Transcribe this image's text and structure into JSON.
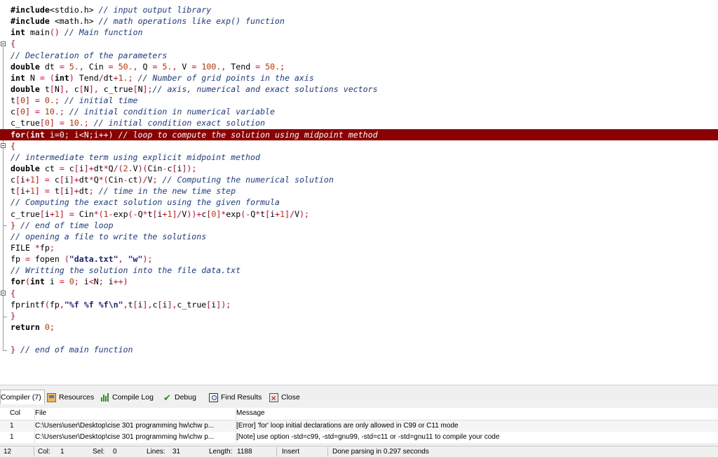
{
  "editor": {
    "lines": [
      [
        [
          "k",
          "#include"
        ],
        [
          "t",
          "<stdio.h> "
        ],
        [
          "c",
          "// input output library"
        ]
      ],
      [
        [
          "k",
          "#include "
        ],
        [
          "t",
          "<math.h> "
        ],
        [
          "c",
          "// math operations like exp() function"
        ]
      ],
      [
        [
          "k",
          "int "
        ],
        [
          "t",
          "main"
        ],
        [
          "o",
          "() "
        ],
        [
          "c",
          "// Main function"
        ]
      ],
      [
        [
          "o",
          "{"
        ]
      ],
      [
        [
          "c",
          "// Decleration of the parameters"
        ]
      ],
      [
        [
          "k",
          "double "
        ],
        [
          "t",
          "dt "
        ],
        [
          "o",
          "= "
        ],
        [
          "n",
          "5."
        ],
        [
          "o",
          ", "
        ],
        [
          "t",
          "Cin "
        ],
        [
          "o",
          "= "
        ],
        [
          "n",
          "50."
        ],
        [
          "o",
          ", "
        ],
        [
          "t",
          "Q "
        ],
        [
          "o",
          "= "
        ],
        [
          "n",
          "5."
        ],
        [
          "o",
          ", "
        ],
        [
          "t",
          "V "
        ],
        [
          "o",
          "= "
        ],
        [
          "n",
          "100."
        ],
        [
          "o",
          ", "
        ],
        [
          "t",
          "Tend "
        ],
        [
          "o",
          "= "
        ],
        [
          "n",
          "50."
        ],
        [
          "o",
          ";"
        ]
      ],
      [
        [
          "k",
          "int "
        ],
        [
          "t",
          "N "
        ],
        [
          "o",
          "= ("
        ],
        [
          "k",
          "int"
        ],
        [
          "o",
          ") "
        ],
        [
          "t",
          "Tend"
        ],
        [
          "o",
          "/"
        ],
        [
          "t",
          "dt"
        ],
        [
          "o",
          "+"
        ],
        [
          "n",
          "1."
        ],
        [
          "o",
          "; "
        ],
        [
          "c",
          "// Number of grid points in the axis"
        ]
      ],
      [
        [
          "k",
          "double "
        ],
        [
          "t",
          "t"
        ],
        [
          "o",
          "["
        ],
        [
          "t",
          "N"
        ],
        [
          "o",
          "], "
        ],
        [
          "t",
          "c"
        ],
        [
          "o",
          "["
        ],
        [
          "t",
          "N"
        ],
        [
          "o",
          "], "
        ],
        [
          "t",
          "c_true"
        ],
        [
          "o",
          "["
        ],
        [
          "t",
          "N"
        ],
        [
          "o",
          "];"
        ],
        [
          "c",
          "// axis, numerical and exact solutions vectors"
        ]
      ],
      [
        [
          "t",
          "t"
        ],
        [
          "o",
          "["
        ],
        [
          "n",
          "0"
        ],
        [
          "o",
          "] = "
        ],
        [
          "n",
          "0."
        ],
        [
          "o",
          "; "
        ],
        [
          "c",
          "// initial time"
        ]
      ],
      [
        [
          "t",
          "c"
        ],
        [
          "o",
          "["
        ],
        [
          "n",
          "0"
        ],
        [
          "o",
          "] = "
        ],
        [
          "n",
          "10."
        ],
        [
          "o",
          "; "
        ],
        [
          "c",
          "// initial condition in numerical variable"
        ]
      ],
      [
        [
          "t",
          "c_true"
        ],
        [
          "o",
          "["
        ],
        [
          "n",
          "0"
        ],
        [
          "o",
          "] = "
        ],
        [
          "n",
          "10."
        ],
        [
          "o",
          "; "
        ],
        [
          "c",
          "// initial condition exact solution"
        ]
      ],
      [
        [
          "k",
          "for"
        ],
        [
          "o",
          "("
        ],
        [
          "k",
          "int "
        ],
        [
          "t",
          "i"
        ],
        [
          "o",
          "="
        ],
        [
          "n",
          "0"
        ],
        [
          "o",
          "; "
        ],
        [
          "t",
          "i"
        ],
        [
          "o",
          "<"
        ],
        [
          "t",
          "N"
        ],
        [
          "o",
          ";"
        ],
        [
          "t",
          "i"
        ],
        [
          "o",
          "++) "
        ],
        [
          "c",
          "// loop to compute the solution using midpoint method"
        ]
      ],
      [
        [
          "o",
          "{"
        ]
      ],
      [
        [
          "c",
          "// intermediate term using explicit midpoint method"
        ]
      ],
      [
        [
          "k",
          "double "
        ],
        [
          "t",
          "ct "
        ],
        [
          "o",
          "= "
        ],
        [
          "t",
          "c"
        ],
        [
          "o",
          "["
        ],
        [
          "t",
          "i"
        ],
        [
          "o",
          "]+"
        ],
        [
          "t",
          "dt"
        ],
        [
          "o",
          "*"
        ],
        [
          "t",
          "Q"
        ],
        [
          "o",
          "/("
        ],
        [
          "n",
          "2."
        ],
        [
          "t",
          "V"
        ],
        [
          "o",
          ")("
        ],
        [
          "t",
          "Cin"
        ],
        [
          "o",
          "-"
        ],
        [
          "t",
          "c"
        ],
        [
          "o",
          "["
        ],
        [
          "t",
          "i"
        ],
        [
          "o",
          "]);"
        ]
      ],
      [
        [
          "t",
          "c"
        ],
        [
          "o",
          "["
        ],
        [
          "t",
          "i"
        ],
        [
          "o",
          "+"
        ],
        [
          "n",
          "1"
        ],
        [
          "o",
          "] = "
        ],
        [
          "t",
          "c"
        ],
        [
          "o",
          "["
        ],
        [
          "t",
          "i"
        ],
        [
          "o",
          "]+"
        ],
        [
          "t",
          "dt"
        ],
        [
          "o",
          "*"
        ],
        [
          "t",
          "Q"
        ],
        [
          "o",
          "*("
        ],
        [
          "t",
          "Cin"
        ],
        [
          "o",
          "-"
        ],
        [
          "t",
          "ct"
        ],
        [
          "o",
          ")/"
        ],
        [
          "t",
          "V"
        ],
        [
          "o",
          "; "
        ],
        [
          "c",
          "// Computing the numerical solution"
        ]
      ],
      [
        [
          "t",
          "t"
        ],
        [
          "o",
          "["
        ],
        [
          "t",
          "i"
        ],
        [
          "o",
          "+"
        ],
        [
          "n",
          "1"
        ],
        [
          "o",
          "] = "
        ],
        [
          "t",
          "t"
        ],
        [
          "o",
          "["
        ],
        [
          "t",
          "i"
        ],
        [
          "o",
          "]+"
        ],
        [
          "t",
          "dt"
        ],
        [
          "o",
          "; "
        ],
        [
          "c",
          "// time in the new time step"
        ]
      ],
      [
        [
          "c",
          "// Computing the exact solution using the given formula"
        ]
      ],
      [
        [
          "t",
          "c_true"
        ],
        [
          "o",
          "["
        ],
        [
          "t",
          "i"
        ],
        [
          "o",
          "+"
        ],
        [
          "n",
          "1"
        ],
        [
          "o",
          "] = "
        ],
        [
          "t",
          "Cin"
        ],
        [
          "o",
          "*("
        ],
        [
          "n",
          "1"
        ],
        [
          "o",
          "-"
        ],
        [
          "t",
          "exp"
        ],
        [
          "o",
          "(-"
        ],
        [
          "t",
          "Q"
        ],
        [
          "o",
          "*"
        ],
        [
          "t",
          "t"
        ],
        [
          "o",
          "["
        ],
        [
          "t",
          "i"
        ],
        [
          "o",
          "+"
        ],
        [
          "n",
          "1"
        ],
        [
          "o",
          "]/"
        ],
        [
          "t",
          "V"
        ],
        [
          "o",
          "))+"
        ],
        [
          "t",
          "c"
        ],
        [
          "o",
          "["
        ],
        [
          "n",
          "0"
        ],
        [
          "o",
          "]*"
        ],
        [
          "t",
          "exp"
        ],
        [
          "o",
          "(-"
        ],
        [
          "t",
          "Q"
        ],
        [
          "o",
          "*"
        ],
        [
          "t",
          "t"
        ],
        [
          "o",
          "["
        ],
        [
          "t",
          "i"
        ],
        [
          "o",
          "+"
        ],
        [
          "n",
          "1"
        ],
        [
          "o",
          "]/"
        ],
        [
          "t",
          "V"
        ],
        [
          "o",
          ");"
        ]
      ],
      [
        [
          "o",
          "} "
        ],
        [
          "c",
          "// end of time loop"
        ]
      ],
      [
        [
          "c",
          "// opening a file to write the solutions"
        ]
      ],
      [
        [
          "t",
          "FILE "
        ],
        [
          "o",
          "*"
        ],
        [
          "t",
          "fp"
        ],
        [
          "o",
          ";"
        ]
      ],
      [
        [
          "t",
          "fp "
        ],
        [
          "o",
          "= "
        ],
        [
          "t",
          "fopen "
        ],
        [
          "o",
          "("
        ],
        [
          "s",
          "\"data.txt\""
        ],
        [
          "o",
          ", "
        ],
        [
          "s",
          "\"w\""
        ],
        [
          "o",
          ");"
        ]
      ],
      [
        [
          "c",
          "// Writting the solution into the file data.txt"
        ]
      ],
      [
        [
          "k",
          "for"
        ],
        [
          "o",
          "("
        ],
        [
          "k",
          "int "
        ],
        [
          "t",
          "i "
        ],
        [
          "o",
          "= "
        ],
        [
          "n",
          "0"
        ],
        [
          "o",
          "; "
        ],
        [
          "t",
          "i"
        ],
        [
          "o",
          "<"
        ],
        [
          "t",
          "N"
        ],
        [
          "o",
          "; "
        ],
        [
          "t",
          "i"
        ],
        [
          "o",
          "++)"
        ]
      ],
      [
        [
          "o",
          "{"
        ]
      ],
      [
        [
          "t",
          "fprintf"
        ],
        [
          "o",
          "("
        ],
        [
          "t",
          "fp"
        ],
        [
          "o",
          ","
        ],
        [
          "s",
          "\"%f %f %f\\n\""
        ],
        [
          "o",
          ","
        ],
        [
          "t",
          "t"
        ],
        [
          "o",
          "["
        ],
        [
          "t",
          "i"
        ],
        [
          "o",
          "],"
        ],
        [
          "t",
          "c"
        ],
        [
          "o",
          "["
        ],
        [
          "t",
          "i"
        ],
        [
          "o",
          "],"
        ],
        [
          "t",
          "c_true"
        ],
        [
          "o",
          "["
        ],
        [
          "t",
          "i"
        ],
        [
          "o",
          "]);"
        ]
      ],
      [
        [
          "o",
          "}"
        ]
      ],
      [
        [
          "k",
          "return "
        ],
        [
          "n",
          "0"
        ],
        [
          "o",
          ";"
        ]
      ],
      [
        [
          "t",
          ""
        ]
      ],
      [
        [
          "o",
          "} "
        ],
        [
          "c",
          "// end of main function"
        ]
      ]
    ],
    "highlighted_line": 11
  },
  "panel": {
    "tabs": {
      "compiler": "Compiler (7)",
      "resources": "Resources",
      "compile_log": "Compile Log",
      "debug": "Debug",
      "find_results": "Find Results",
      "close": "Close"
    },
    "table": {
      "headers": {
        "col": "Col",
        "file": "File",
        "message": "Message"
      },
      "rows": [
        {
          "col": "1",
          "file": "C:\\Users\\user\\Desktop\\cise 301 programming hw\\chw p...",
          "message": "[Error] 'for' loop initial declarations are only allowed in C99 or C11 mode"
        },
        {
          "col": "1",
          "file": "C:\\Users\\user\\Desktop\\cise 301 programming hw\\chw p...",
          "message": "[Note] use option -std=c99, -std=gnu99, -std=c11 or -std=gnu11 to compile your code"
        }
      ]
    }
  },
  "statusbar": {
    "line": "12",
    "col_label": "Col:",
    "col": "1",
    "sel_label": "Sel:",
    "sel": "0",
    "lines_label": "Lines:",
    "lines": "31",
    "length_label": "Length:",
    "length": "1188",
    "mode": "Insert",
    "status": "Done parsing in 0.297 seconds"
  }
}
